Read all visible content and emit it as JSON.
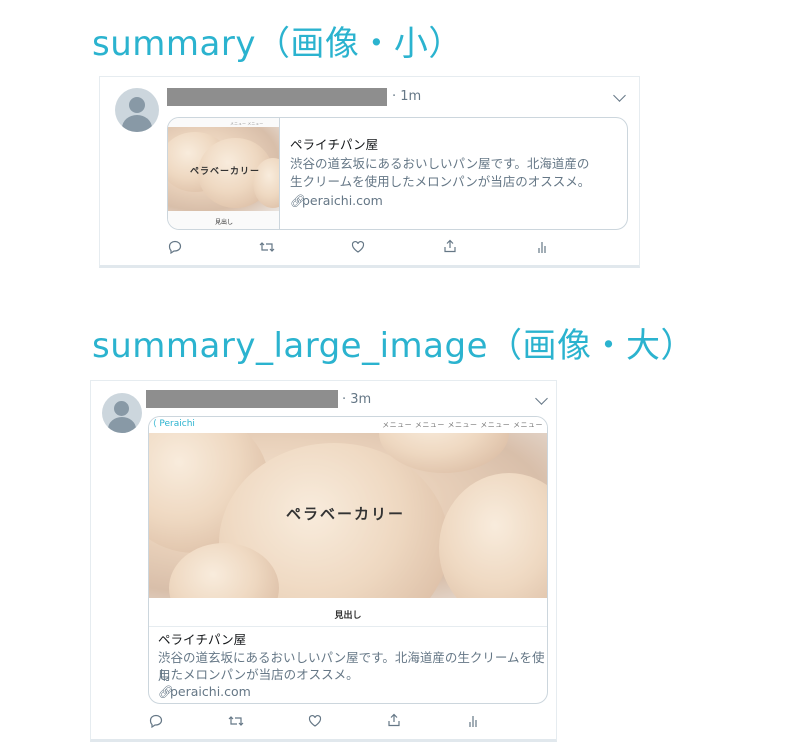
{
  "section1": {
    "heading": "summary（画像・小）",
    "tweet": {
      "time": "· 1m",
      "card": {
        "thumb_menu": "メニュー メニュー",
        "thumb_title": "ペラベーカリー",
        "thumb_heading": "見出し",
        "title": "ペライチパン屋",
        "desc_line1": "渋谷の道玄坂にあるおいしいパン屋です。北海道産の",
        "desc_line2": "生クリームを使用したメロンパンが当店のオススメ。",
        "domain": "peraichi.com"
      },
      "actions": [
        "reply-icon",
        "retweet-icon",
        "like-icon",
        "share-icon",
        "analytics-icon"
      ]
    }
  },
  "section2": {
    "heading": "summary_large_image（画像・大）",
    "tweet": {
      "time": "· 3m",
      "card": {
        "brand": "Peraichi",
        "menus": "メニュー メニュー メニュー メニュー メニュー",
        "image_title": "ペラベーカリー",
        "image_heading": "見出し",
        "title": "ペライチパン屋",
        "desc_line1": "渋谷の道玄坂にあるおいしいパン屋です。北海道産の生クリームを使用",
        "desc_line2": "したメロンパンが当店のオススメ。",
        "domain": "peraichi.com"
      },
      "actions": [
        "reply-icon",
        "retweet-icon",
        "like-icon",
        "share-icon",
        "analytics-icon"
      ]
    }
  },
  "colors": {
    "heading": "#2bb3cf",
    "secondary_text": "#657786",
    "border": "#ccd6dd",
    "name_redaction": "#8e8e8e"
  }
}
